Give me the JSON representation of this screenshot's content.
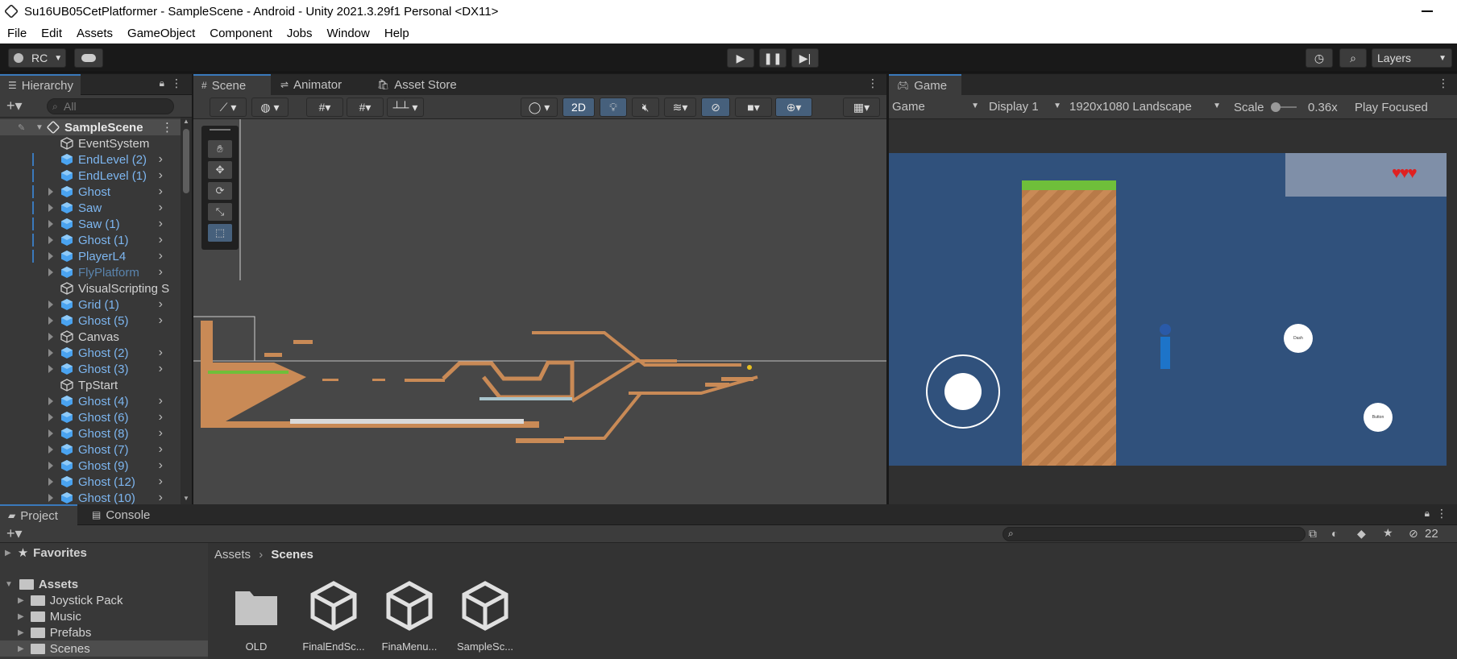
{
  "window": {
    "title": "Su16UB05CetPlatformer - SampleScene - Android - Unity 2021.3.29f1 Personal <DX11>"
  },
  "menu": [
    "File",
    "Edit",
    "Assets",
    "GameObject",
    "Component",
    "Jobs",
    "Window",
    "Help"
  ],
  "toolbar": {
    "account": "RC",
    "layers": "Layers"
  },
  "hierarchy": {
    "tab": "Hierarchy",
    "search_placeholder": "All",
    "scene_name": "SampleScene",
    "items": [
      {
        "label": "EventSystem",
        "style": "white"
      },
      {
        "label": "EndLevel (2)",
        "style": "blue"
      },
      {
        "label": "EndLevel (1)",
        "style": "blue"
      },
      {
        "label": "Ghost",
        "style": "blue"
      },
      {
        "label": "Saw",
        "style": "blue"
      },
      {
        "label": "Saw (1)",
        "style": "blue"
      },
      {
        "label": "Ghost (1)",
        "style": "blue"
      },
      {
        "label": "PlayerL4",
        "style": "blue"
      },
      {
        "label": "FlyPlatform",
        "style": "faded"
      },
      {
        "label": "VisualScripting S",
        "style": "white"
      },
      {
        "label": "Grid (1)",
        "style": "blue"
      },
      {
        "label": "Ghost (5)",
        "style": "blue"
      },
      {
        "label": "Canvas",
        "style": "white"
      },
      {
        "label": "Ghost (2)",
        "style": "blue"
      },
      {
        "label": "Ghost (3)",
        "style": "blue"
      },
      {
        "label": "TpStart",
        "style": "white"
      },
      {
        "label": "Ghost (4)",
        "style": "blue"
      },
      {
        "label": "Ghost (6)",
        "style": "blue"
      },
      {
        "label": "Ghost (8)",
        "style": "blue"
      },
      {
        "label": "Ghost (7)",
        "style": "blue"
      },
      {
        "label": "Ghost (9)",
        "style": "blue"
      },
      {
        "label": "Ghost (12)",
        "style": "blue"
      },
      {
        "label": "Ghost (10)",
        "style": "blue"
      }
    ]
  },
  "scene_tabs": {
    "scene": "Scene",
    "animator": "Animator",
    "asset_store": "Asset Store"
  },
  "scene_toolbar": {
    "mode_2d": "2D"
  },
  "game": {
    "tab": "Game",
    "mode": "Game",
    "display": "Display 1",
    "resolution": "1920x1080 Landscape",
    "scale_label": "Scale",
    "scale_value": "0.36x",
    "play_focused": "Play Focused",
    "button_a": "Dash",
    "button_b": "Button"
  },
  "project": {
    "tab_project": "Project",
    "tab_console": "Console",
    "hidden_count": "22",
    "favorites": "Favorites",
    "assets_root": "Assets",
    "folders": [
      "Joystick Pack",
      "Music",
      "Prefabs",
      "Scenes"
    ],
    "breadcrumb": [
      "Assets",
      "Scenes"
    ],
    "files": [
      "OLD",
      "FinalEndSc...",
      "FinaMenu...",
      "SampleSc..."
    ]
  },
  "colors": {
    "accent": "#3a79bb",
    "prefab_blue": "#7db6f0",
    "game_sky": "#30517c",
    "dirt": "#c98a56",
    "grass": "#6fbf3a"
  }
}
